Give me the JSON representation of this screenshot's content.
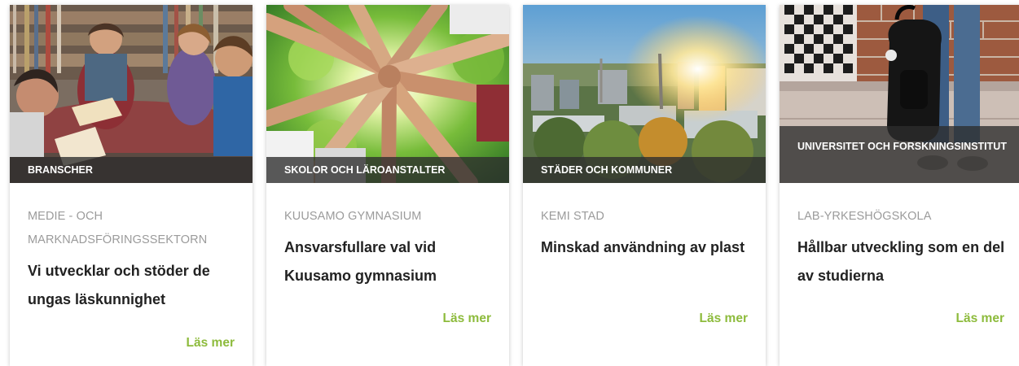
{
  "accent_color": "#8dbb3c",
  "cards": [
    {
      "category": "BRANSCHER",
      "org": "MEDIE - OCH MARKNADSFÖRINGSSEKTORN",
      "title": "Vi utvecklar och stöder de ungas läskunnighet",
      "link": "Läs mer"
    },
    {
      "category": "SKOLOR OCH LÄROANSTALTER",
      "org": "KUUSAMO GYMNASIUM",
      "title": "Ansvarsfullare val vid Kuusamo gymnasium",
      "link": "Läs mer"
    },
    {
      "category": "STÄDER OCH KOMMUNER",
      "org": "KEMI STAD",
      "title": "Minskad användning av plast",
      "link": "Läs mer"
    },
    {
      "category": "UNIVERSITET OCH FORSKNINGSINSTITUT",
      "org": "LAB-YRKESHÖGSKOLA",
      "title": "Hållbar utveckling som en del av studierna",
      "link": "Läs mer"
    }
  ]
}
